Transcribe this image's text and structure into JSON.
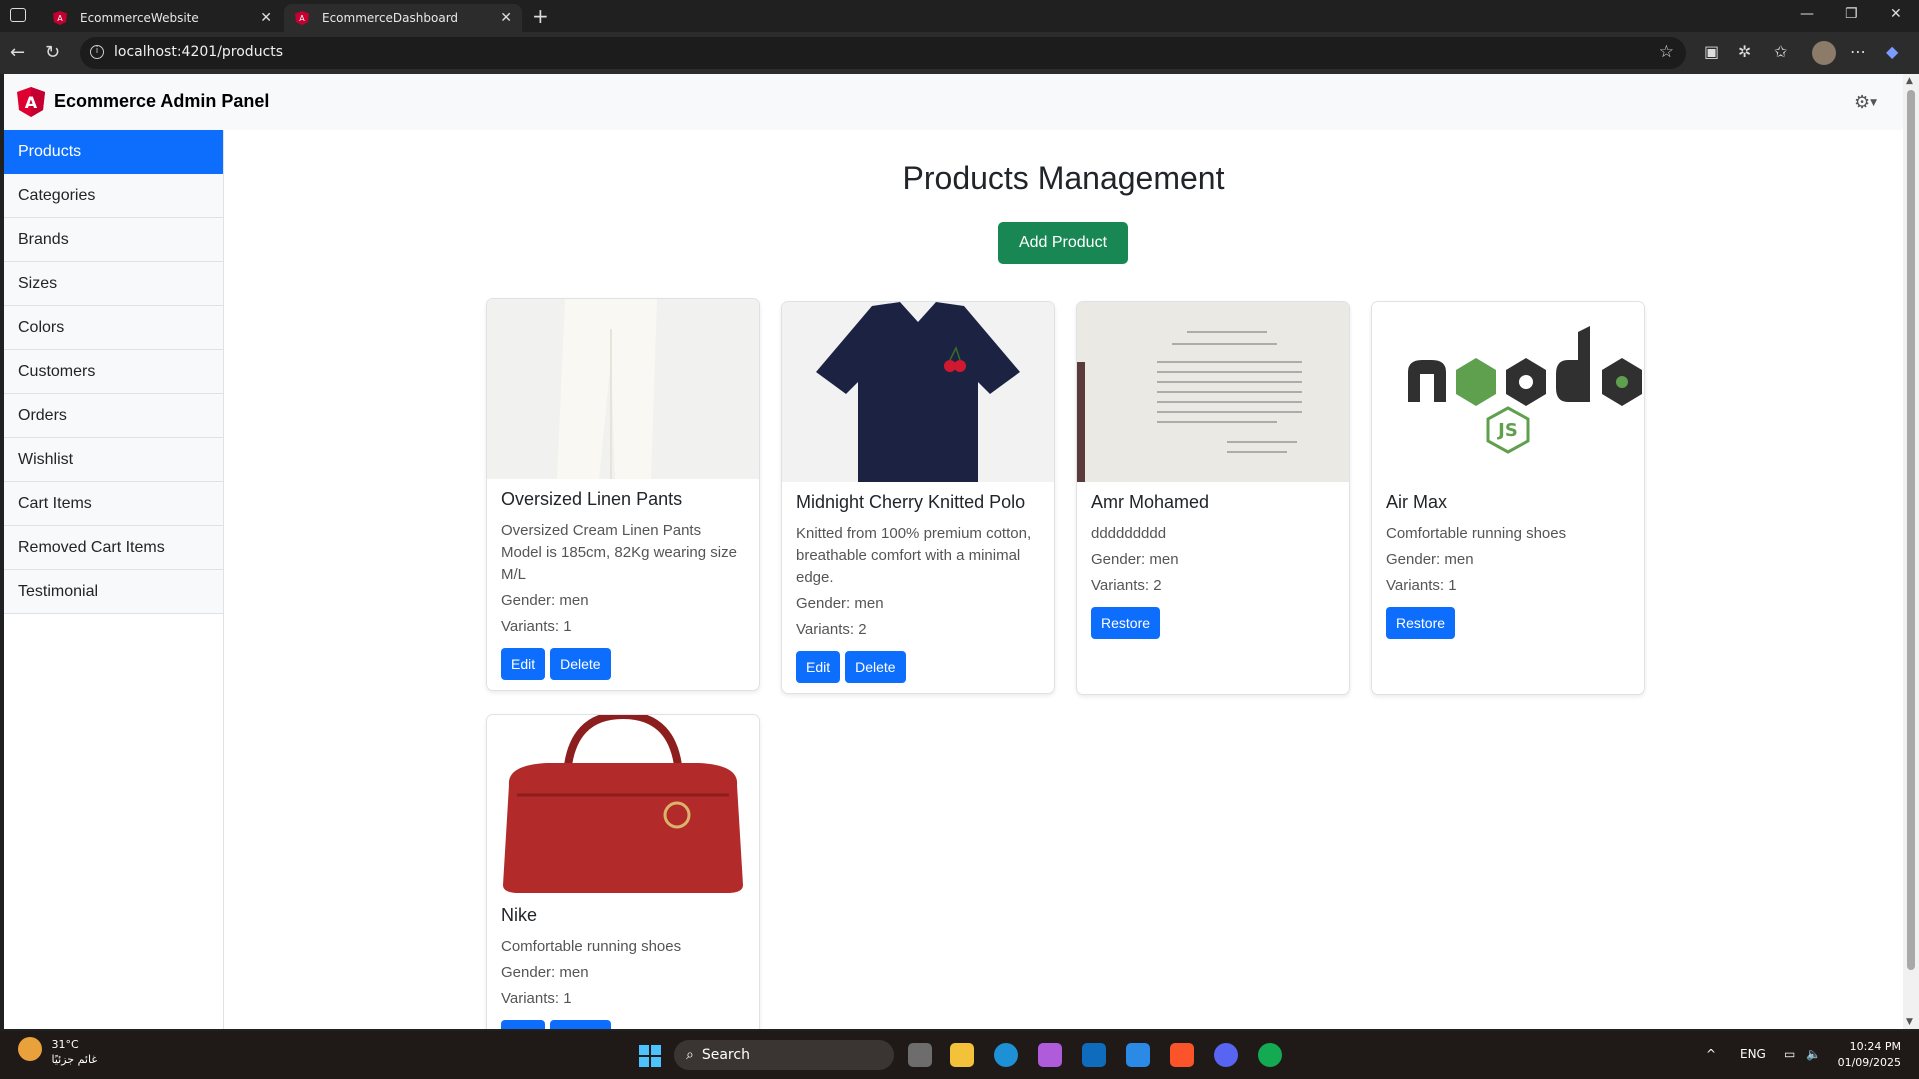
{
  "browser": {
    "tabs": [
      {
        "title": "EcommerceWebsite",
        "active": false
      },
      {
        "title": "EcommerceDashboard",
        "active": true
      }
    ],
    "url": "localhost:4201/products"
  },
  "header": {
    "title": "Ecommerce Admin Panel"
  },
  "sidebar": {
    "items": [
      {
        "label": "Products",
        "active": true
      },
      {
        "label": "Categories"
      },
      {
        "label": "Brands"
      },
      {
        "label": "Sizes"
      },
      {
        "label": "Colors"
      },
      {
        "label": "Customers"
      },
      {
        "label": "Orders"
      },
      {
        "label": "Wishlist"
      },
      {
        "label": "Cart Items"
      },
      {
        "label": "Removed Cart Items"
      },
      {
        "label": "Testimonial"
      }
    ]
  },
  "main": {
    "title": "Products Management",
    "add_label": "Add Product",
    "products": [
      {
        "name": "Oversized Linen Pants",
        "description": "Oversized Cream Linen Pants Model is 185cm, 82Kg wearing size M/L",
        "gender": "Gender: men",
        "variants": "Variants: 1",
        "edit_label": "Edit",
        "delete_label": "Delete"
      },
      {
        "name": "Midnight Cherry Knitted Polo",
        "description": "Knitted from 100% premium cotton, breathable comfort with a minimal edge.",
        "gender": "Gender: men",
        "variants": "Variants: 2",
        "edit_label": "Edit",
        "delete_label": "Delete"
      },
      {
        "name": "Amr Mohamed",
        "description": "ddddddddd",
        "gender": "Gender: men",
        "variants": "Variants: 2",
        "restore_label": "Restore"
      },
      {
        "name": "Air Max",
        "description": "Comfortable running shoes",
        "gender": "Gender: men",
        "variants": "Variants: 1",
        "restore_label": "Restore"
      },
      {
        "name": "Nike",
        "description": "Comfortable running shoes",
        "gender": "Gender: men",
        "variants": "Variants: 1",
        "edit_label": "Edit",
        "delete_label": "Delete"
      }
    ]
  },
  "taskbar": {
    "temperature": "31°C",
    "weather_text": "غائم جزئيًا",
    "search_label": "Search",
    "language": "ENG",
    "time": "10:24 PM",
    "date": "01/09/2025"
  },
  "colors": {
    "primary": "#0d6efd",
    "success": "#198754",
    "angular_red": "#dd0031"
  }
}
